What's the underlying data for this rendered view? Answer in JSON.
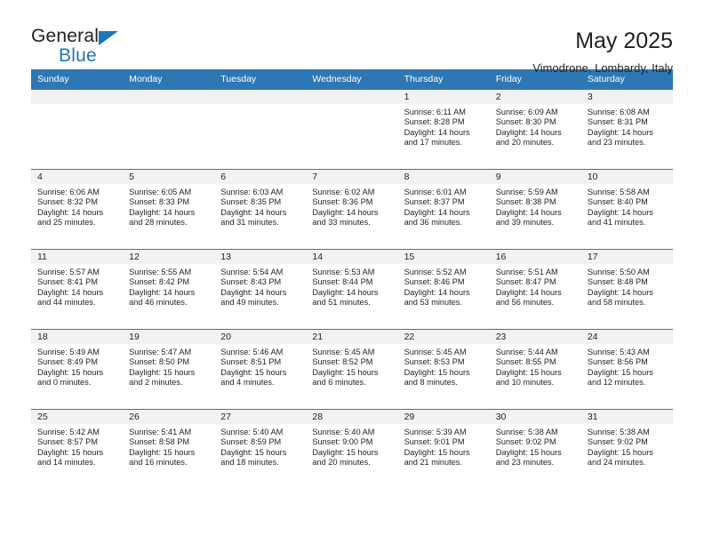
{
  "brand": {
    "name_top": "General",
    "name_bottom": "Blue",
    "triangle_icon": "triangle-icon",
    "color_blue": "#1c76bc",
    "color_dark": "#231f20"
  },
  "header": {
    "title": "May 2025",
    "subtitle": "Vimodrone, Lombardy, Italy"
  },
  "theme": {
    "header_bg": "#2e77b5",
    "daynum_bg": "#f2f2f2",
    "text": "#231f20",
    "cell_bg": "#ffffff"
  },
  "weekdays": [
    "Sunday",
    "Monday",
    "Tuesday",
    "Wednesday",
    "Thursday",
    "Friday",
    "Saturday"
  ],
  "weeks": [
    [
      {
        "day": "",
        "lines": []
      },
      {
        "day": "",
        "lines": []
      },
      {
        "day": "",
        "lines": []
      },
      {
        "day": "",
        "lines": []
      },
      {
        "day": "1",
        "lines": [
          "Sunrise: 6:11 AM",
          "Sunset: 8:28 PM",
          "Daylight: 14 hours",
          "and 17 minutes."
        ]
      },
      {
        "day": "2",
        "lines": [
          "Sunrise: 6:09 AM",
          "Sunset: 8:30 PM",
          "Daylight: 14 hours",
          "and 20 minutes."
        ]
      },
      {
        "day": "3",
        "lines": [
          "Sunrise: 6:08 AM",
          "Sunset: 8:31 PM",
          "Daylight: 14 hours",
          "and 23 minutes."
        ]
      }
    ],
    [
      {
        "day": "4",
        "lines": [
          "Sunrise: 6:06 AM",
          "Sunset: 8:32 PM",
          "Daylight: 14 hours",
          "and 25 minutes."
        ]
      },
      {
        "day": "5",
        "lines": [
          "Sunrise: 6:05 AM",
          "Sunset: 8:33 PM",
          "Daylight: 14 hours",
          "and 28 minutes."
        ]
      },
      {
        "day": "6",
        "lines": [
          "Sunrise: 6:03 AM",
          "Sunset: 8:35 PM",
          "Daylight: 14 hours",
          "and 31 minutes."
        ]
      },
      {
        "day": "7",
        "lines": [
          "Sunrise: 6:02 AM",
          "Sunset: 8:36 PM",
          "Daylight: 14 hours",
          "and 33 minutes."
        ]
      },
      {
        "day": "8",
        "lines": [
          "Sunrise: 6:01 AM",
          "Sunset: 8:37 PM",
          "Daylight: 14 hours",
          "and 36 minutes."
        ]
      },
      {
        "day": "9",
        "lines": [
          "Sunrise: 5:59 AM",
          "Sunset: 8:38 PM",
          "Daylight: 14 hours",
          "and 39 minutes."
        ]
      },
      {
        "day": "10",
        "lines": [
          "Sunrise: 5:58 AM",
          "Sunset: 8:40 PM",
          "Daylight: 14 hours",
          "and 41 minutes."
        ]
      }
    ],
    [
      {
        "day": "11",
        "lines": [
          "Sunrise: 5:57 AM",
          "Sunset: 8:41 PM",
          "Daylight: 14 hours",
          "and 44 minutes."
        ]
      },
      {
        "day": "12",
        "lines": [
          "Sunrise: 5:55 AM",
          "Sunset: 8:42 PM",
          "Daylight: 14 hours",
          "and 46 minutes."
        ]
      },
      {
        "day": "13",
        "lines": [
          "Sunrise: 5:54 AM",
          "Sunset: 8:43 PM",
          "Daylight: 14 hours",
          "and 49 minutes."
        ]
      },
      {
        "day": "14",
        "lines": [
          "Sunrise: 5:53 AM",
          "Sunset: 8:44 PM",
          "Daylight: 14 hours",
          "and 51 minutes."
        ]
      },
      {
        "day": "15",
        "lines": [
          "Sunrise: 5:52 AM",
          "Sunset: 8:46 PM",
          "Daylight: 14 hours",
          "and 53 minutes."
        ]
      },
      {
        "day": "16",
        "lines": [
          "Sunrise: 5:51 AM",
          "Sunset: 8:47 PM",
          "Daylight: 14 hours",
          "and 56 minutes."
        ]
      },
      {
        "day": "17",
        "lines": [
          "Sunrise: 5:50 AM",
          "Sunset: 8:48 PM",
          "Daylight: 14 hours",
          "and 58 minutes."
        ]
      }
    ],
    [
      {
        "day": "18",
        "lines": [
          "Sunrise: 5:49 AM",
          "Sunset: 8:49 PM",
          "Daylight: 15 hours",
          "and 0 minutes."
        ]
      },
      {
        "day": "19",
        "lines": [
          "Sunrise: 5:47 AM",
          "Sunset: 8:50 PM",
          "Daylight: 15 hours",
          "and 2 minutes."
        ]
      },
      {
        "day": "20",
        "lines": [
          "Sunrise: 5:46 AM",
          "Sunset: 8:51 PM",
          "Daylight: 15 hours",
          "and 4 minutes."
        ]
      },
      {
        "day": "21",
        "lines": [
          "Sunrise: 5:45 AM",
          "Sunset: 8:52 PM",
          "Daylight: 15 hours",
          "and 6 minutes."
        ]
      },
      {
        "day": "22",
        "lines": [
          "Sunrise: 5:45 AM",
          "Sunset: 8:53 PM",
          "Daylight: 15 hours",
          "and 8 minutes."
        ]
      },
      {
        "day": "23",
        "lines": [
          "Sunrise: 5:44 AM",
          "Sunset: 8:55 PM",
          "Daylight: 15 hours",
          "and 10 minutes."
        ]
      },
      {
        "day": "24",
        "lines": [
          "Sunrise: 5:43 AM",
          "Sunset: 8:56 PM",
          "Daylight: 15 hours",
          "and 12 minutes."
        ]
      }
    ],
    [
      {
        "day": "25",
        "lines": [
          "Sunrise: 5:42 AM",
          "Sunset: 8:57 PM",
          "Daylight: 15 hours",
          "and 14 minutes."
        ]
      },
      {
        "day": "26",
        "lines": [
          "Sunrise: 5:41 AM",
          "Sunset: 8:58 PM",
          "Daylight: 15 hours",
          "and 16 minutes."
        ]
      },
      {
        "day": "27",
        "lines": [
          "Sunrise: 5:40 AM",
          "Sunset: 8:59 PM",
          "Daylight: 15 hours",
          "and 18 minutes."
        ]
      },
      {
        "day": "28",
        "lines": [
          "Sunrise: 5:40 AM",
          "Sunset: 9:00 PM",
          "Daylight: 15 hours",
          "and 20 minutes."
        ]
      },
      {
        "day": "29",
        "lines": [
          "Sunrise: 5:39 AM",
          "Sunset: 9:01 PM",
          "Daylight: 15 hours",
          "and 21 minutes."
        ]
      },
      {
        "day": "30",
        "lines": [
          "Sunrise: 5:38 AM",
          "Sunset: 9:02 PM",
          "Daylight: 15 hours",
          "and 23 minutes."
        ]
      },
      {
        "day": "31",
        "lines": [
          "Sunrise: 5:38 AM",
          "Sunset: 9:02 PM",
          "Daylight: 15 hours",
          "and 24 minutes."
        ]
      }
    ]
  ]
}
